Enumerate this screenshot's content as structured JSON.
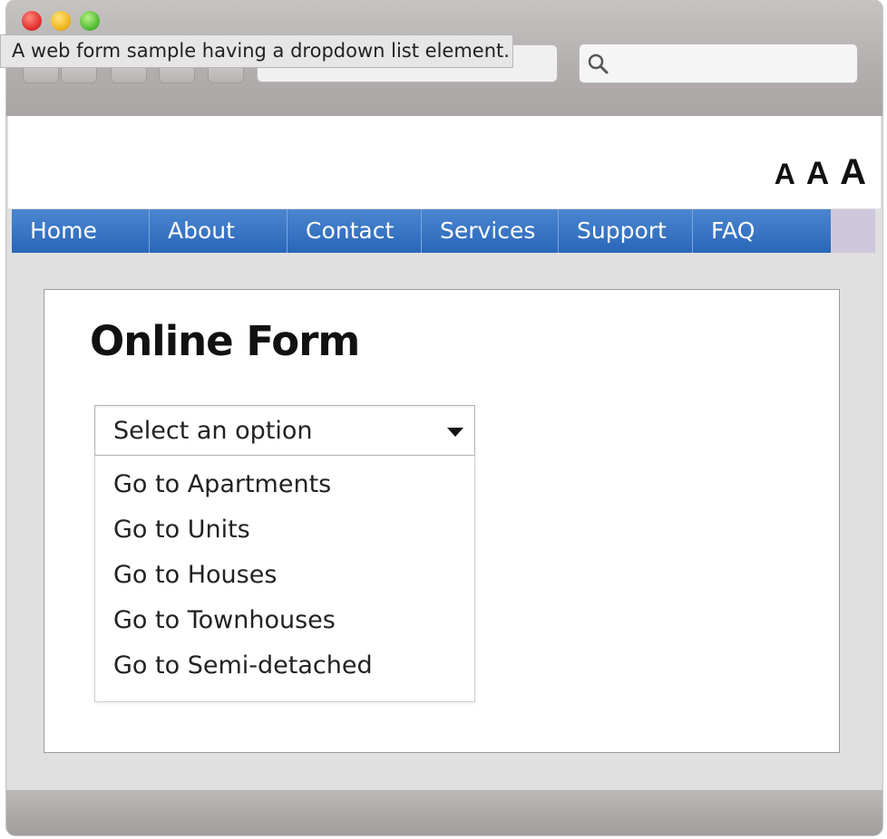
{
  "tooltip": {
    "text": "A web form sample having a dropdown list element."
  },
  "font_size_controls": [
    "A",
    "A",
    "A"
  ],
  "nav": {
    "items": [
      "Home",
      "About",
      "Contact",
      "Services",
      "Support",
      "FAQ"
    ]
  },
  "form": {
    "title": "Online Form",
    "select": {
      "value": "Select an option",
      "options": [
        "Go to Apartments",
        "Go to Units",
        "Go to Houses",
        "Go to Townhouses",
        "Go to Semi-detached"
      ]
    }
  },
  "icons": {
    "search": "search-icon",
    "dropdown": "caret-down-icon"
  },
  "colors": {
    "nav_bg": "#2a66b8",
    "nav_strip": "#cfc7dd",
    "traffic_red": "#e3342f",
    "traffic_yellow": "#f2b824",
    "traffic_green": "#57c038"
  }
}
